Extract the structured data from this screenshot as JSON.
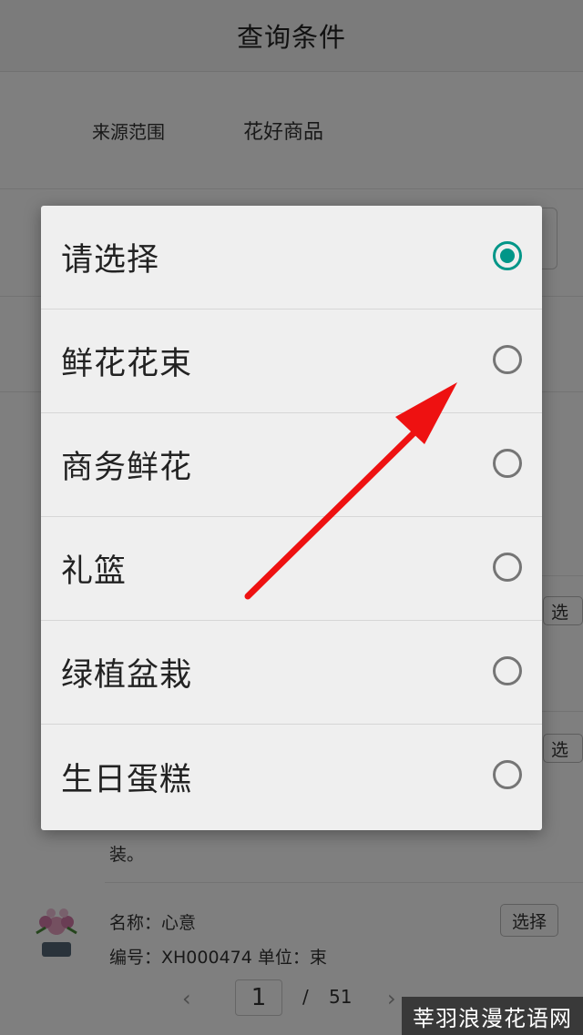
{
  "header": {
    "title": "查询条件"
  },
  "filters": {
    "source_label": "来源范围",
    "source_value": "花好商品"
  },
  "list": {
    "partial_button": "选",
    "trailing_text": "装。",
    "item": {
      "name": "名称：心意",
      "code": "编号：XH000474 单位：束",
      "select_label": "选择"
    }
  },
  "pager": {
    "prev": "‹",
    "current": "1",
    "separator": "/",
    "total": "51",
    "next": "›"
  },
  "dialog": {
    "options": [
      {
        "label": "请选择",
        "checked": true
      },
      {
        "label": "鲜花花束",
        "checked": false
      },
      {
        "label": "商务鲜花",
        "checked": false
      },
      {
        "label": "礼篮",
        "checked": false
      },
      {
        "label": "绿植盆栽",
        "checked": false
      },
      {
        "label": "生日蛋糕",
        "checked": false
      }
    ]
  },
  "watermark": "莘羽浪漫花语网",
  "colors": {
    "accent": "#009688",
    "arrow": "#ee1111"
  }
}
